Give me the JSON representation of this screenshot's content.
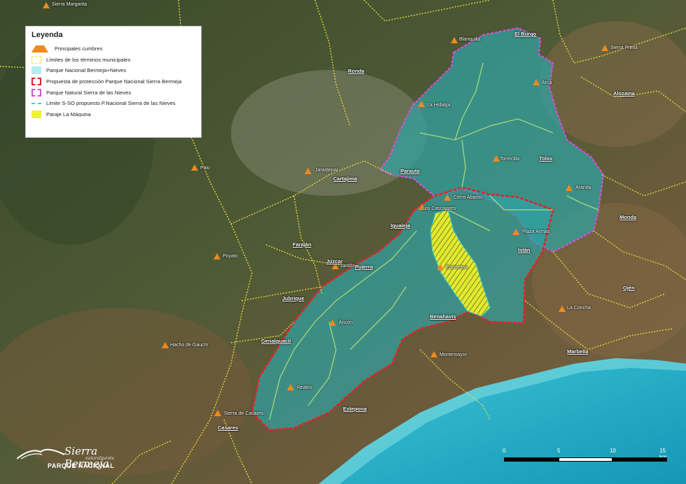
{
  "legend": {
    "title": "Leyenda",
    "items": [
      {
        "label": "Principales cumbres",
        "symbol": "orange-triangle-icon"
      },
      {
        "label": "Límites de los términos municipales",
        "symbol": "yellow-dashed-box-icon"
      },
      {
        "label": "Parque Nacional Bermeja+Nieves",
        "symbol": "teal-fill-icon"
      },
      {
        "label": "Propuesta de protección Parque Nacional Sierra Bermeja",
        "symbol": "red-dashed-box-icon"
      },
      {
        "label": "Parque Natural Sierra de las Nieves",
        "symbol": "magenta-dashed-box-icon"
      },
      {
        "label": "Limite S-SO propuesto P.Nacional Sierra de las Nieves",
        "symbol": "cyan-dashed-line-icon"
      },
      {
        "label": "Paraje La Máquina",
        "symbol": "yellow-fill-icon"
      }
    ]
  },
  "peaks": {
    "sierra_margarita": "Sierra Margarita",
    "blanquilla": "Blanquilla",
    "sierra_prieta": "Sierra Prieta",
    "la_hidalga": "La Hidalga",
    "arca": "Arca",
    "torrecilla": "Torrecilla",
    "jarastepar": "Jarastepar",
    "palo": "Palo",
    "aranda": "Aranda",
    "cerro_abanto": "Cerro Abanto",
    "los_cascajares": "Los Cascajares",
    "plaza_armas": "Plaza Armas",
    "poyato": "Poyato",
    "jardon": "Jardón",
    "encinetas": "Encinetas",
    "la_concha": "La Concha",
    "hacho_gaucin": "Hacho de Gaucín",
    "ancon": "Ancón",
    "montemayor": "Montemayor",
    "reales": "Reales",
    "sierra_casares": "Sierra de Casares"
  },
  "towns": {
    "el_burgo": "El Burgo",
    "ronda": "Ronda",
    "alozaina": "Alozaina",
    "tolox": "Tolox",
    "cartajima": "Cartajima",
    "parauta": "Parauta",
    "igualeja": "Igualeja",
    "monda": "Monda",
    "istan": "Istán",
    "faraján": "Faraján",
    "juzcar": "Júzcar",
    "pujerra": "Pujerra",
    "ojen": "Ojén",
    "jubrique": "Jubrique",
    "benahavis": "Benahavís",
    "genalguacil": "Genalguacil",
    "marbella": "Marbella",
    "estepona": "Estepona",
    "casares": "Casares"
  },
  "scale": {
    "labels": [
      "0",
      "5",
      "10",
      "15 km"
    ]
  },
  "logo": {
    "title": "Sierra Bermeja",
    "subtitle": "naturalmente",
    "np": "PARQUE NACIONAL"
  },
  "colors": {
    "teal_park": "#2fa3a4",
    "red_proposal": "#e0232a",
    "magenta_natural": "#d64fd8",
    "yellow_limits": "#f0e63a",
    "maquina": "#e8ef2a",
    "sea": "#2ab7cf",
    "peak": "#f08a1e"
  }
}
